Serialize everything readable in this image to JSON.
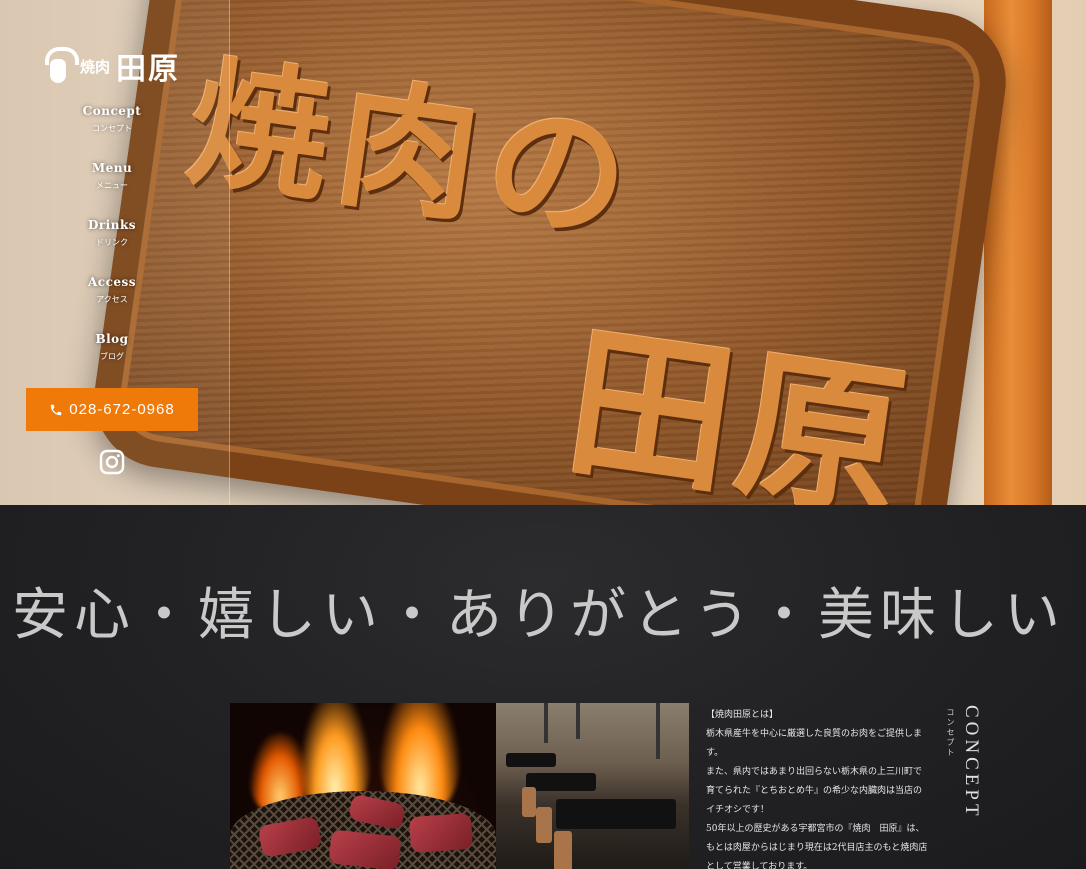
{
  "brand": {
    "small": "焼肉",
    "large": "田原"
  },
  "hero": {
    "sign_line1": "焼肉の",
    "sign_line2": "田原"
  },
  "nav": [
    {
      "en": "Concept",
      "ja": "コンセプト"
    },
    {
      "en": "Menu",
      "ja": "メニュー"
    },
    {
      "en": "Drinks",
      "ja": "ドリンク"
    },
    {
      "en": "Access",
      "ja": "アクセス"
    },
    {
      "en": "Blog",
      "ja": "ブログ"
    }
  ],
  "phone": {
    "number": "028-672-0968",
    "icon": "phone-icon"
  },
  "social": {
    "icon": "instagram-icon"
  },
  "concept": {
    "tagline": "安心・嬉しい・ありがとう・美味しい",
    "heading": "CONCEPT",
    "heading_ja": "コンセプト",
    "paragraph": "【焼肉田原とは】\n栃木県産牛を中心に厳選した良質のお肉をご提供します。\nまた、県内ではあまり出回らない栃木県の上三川町で育てられた『とちおとめ牛』の希少な内臓肉は当店のイチオシです！\n50年以上の歴史がある宇都宮市の『焼肉　田原』は、もとは肉屋からはじまり現在は2代目店主のもと焼肉店として営業しております。\n地元の方はもちろん、遠方からも多くのお客様"
  },
  "colors": {
    "accent": "#ef7a0a",
    "dark_bg": "#1f1f21"
  }
}
